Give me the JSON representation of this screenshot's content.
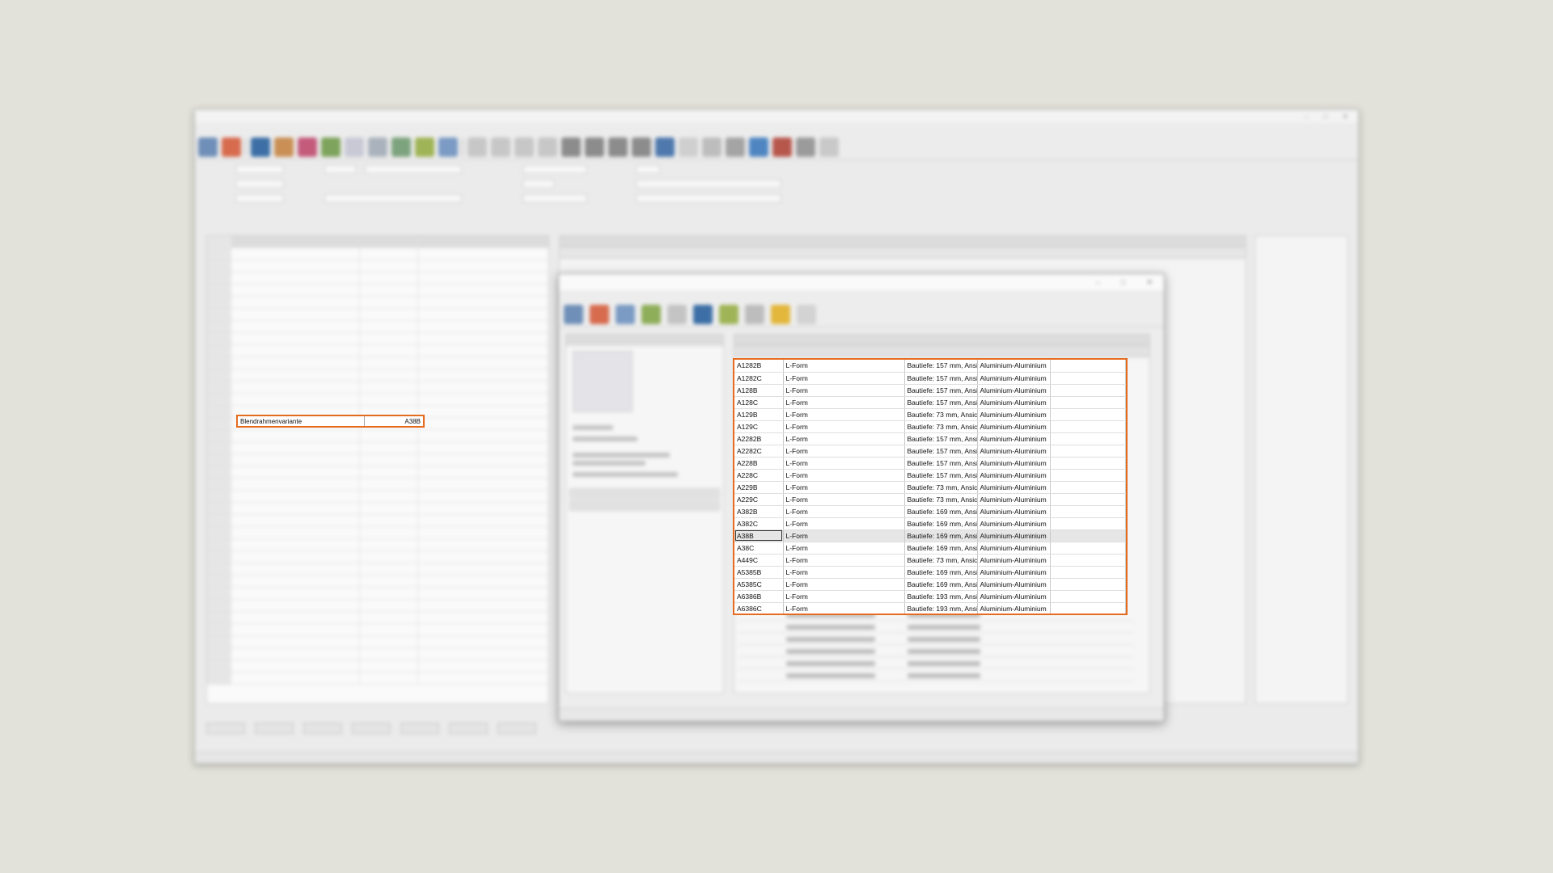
{
  "left_panel": {
    "highlighted_row": {
      "label": "Blendrahmenvariante",
      "value": "A38B"
    }
  },
  "results": {
    "rows": [
      {
        "profil": "A1282B",
        "bezeichnung": "L-Form",
        "bezeichnung2": "Bautiefe: 157 mm, Ansic",
        "material": "Aluminium-Aluminium",
        "bezeichnung3": ""
      },
      {
        "profil": "A1282C",
        "bezeichnung": "L-Form",
        "bezeichnung2": "Bautiefe: 157 mm, Ansic",
        "material": "Aluminium-Aluminium",
        "bezeichnung3": ""
      },
      {
        "profil": "A128B",
        "bezeichnung": "L-Form",
        "bezeichnung2": "Bautiefe: 157 mm, Ansic",
        "material": "Aluminium-Aluminium",
        "bezeichnung3": ""
      },
      {
        "profil": "A128C",
        "bezeichnung": "L-Form",
        "bezeichnung2": "Bautiefe: 157 mm, Ansic",
        "material": "Aluminium-Aluminium",
        "bezeichnung3": ""
      },
      {
        "profil": "A129B",
        "bezeichnung": "L-Form",
        "bezeichnung2": "Bautiefe: 73 mm, Ansic",
        "material": "Aluminium-Aluminium",
        "bezeichnung3": ""
      },
      {
        "profil": "A129C",
        "bezeichnung": "L-Form",
        "bezeichnung2": "Bautiefe: 73 mm, Ansic",
        "material": "Aluminium-Aluminium",
        "bezeichnung3": ""
      },
      {
        "profil": "A2282B",
        "bezeichnung": "L-Form",
        "bezeichnung2": "Bautiefe: 157 mm, Ansic",
        "material": "Aluminium-Aluminium",
        "bezeichnung3": ""
      },
      {
        "profil": "A2282C",
        "bezeichnung": "L-Form",
        "bezeichnung2": "Bautiefe: 157 mm, Ansic",
        "material": "Aluminium-Aluminium",
        "bezeichnung3": ""
      },
      {
        "profil": "A228B",
        "bezeichnung": "L-Form",
        "bezeichnung2": "Bautiefe: 157 mm, Ansic",
        "material": "Aluminium-Aluminium",
        "bezeichnung3": ""
      },
      {
        "profil": "A228C",
        "bezeichnung": "L-Form",
        "bezeichnung2": "Bautiefe: 157 mm, Ansic",
        "material": "Aluminium-Aluminium",
        "bezeichnung3": ""
      },
      {
        "profil": "A229B",
        "bezeichnung": "L-Form",
        "bezeichnung2": "Bautiefe: 73 mm, Ansic",
        "material": "Aluminium-Aluminium",
        "bezeichnung3": ""
      },
      {
        "profil": "A229C",
        "bezeichnung": "L-Form",
        "bezeichnung2": "Bautiefe: 73 mm, Ansic",
        "material": "Aluminium-Aluminium",
        "bezeichnung3": ""
      },
      {
        "profil": "A382B",
        "bezeichnung": "L-Form",
        "bezeichnung2": "Bautiefe: 169 mm, Ansic",
        "material": "Aluminium-Aluminium",
        "bezeichnung3": ""
      },
      {
        "profil": "A382C",
        "bezeichnung": "L-Form",
        "bezeichnung2": "Bautiefe: 169 mm, Ansic",
        "material": "Aluminium-Aluminium",
        "bezeichnung3": ""
      },
      {
        "profil": "A38B",
        "bezeichnung": "L-Form",
        "bezeichnung2": "Bautiefe: 169 mm, Ansic",
        "material": "Aluminium-Aluminium",
        "bezeichnung3": "",
        "selected": true
      },
      {
        "profil": "A38C",
        "bezeichnung": "L-Form",
        "bezeichnung2": "Bautiefe: 169 mm, Ansic",
        "material": "Aluminium-Aluminium",
        "bezeichnung3": ""
      },
      {
        "profil": "A449C",
        "bezeichnung": "L-Form",
        "bezeichnung2": "Bautiefe: 73 mm, Ansic",
        "material": "Aluminium-Aluminium",
        "bezeichnung3": ""
      },
      {
        "profil": "A5385B",
        "bezeichnung": "L-Form",
        "bezeichnung2": "Bautiefe: 169 mm, Ansic",
        "material": "Aluminium-Aluminium",
        "bezeichnung3": ""
      },
      {
        "profil": "A5385C",
        "bezeichnung": "L-Form",
        "bezeichnung2": "Bautiefe: 169 mm, Ansic",
        "material": "Aluminium-Aluminium",
        "bezeichnung3": ""
      },
      {
        "profil": "A6386B",
        "bezeichnung": "L-Form",
        "bezeichnung2": "Bautiefe: 193 mm, Ansic",
        "material": "Aluminium-Aluminium",
        "bezeichnung3": ""
      },
      {
        "profil": "A6386C",
        "bezeichnung": "L-Form",
        "bezeichnung2": "Bautiefe: 193 mm, Ansic",
        "material": "Aluminium-Aluminium",
        "bezeichnung3": ""
      }
    ]
  },
  "colors": {
    "highlight": "#e56b1f",
    "selected_row": "#e6e6e6"
  }
}
